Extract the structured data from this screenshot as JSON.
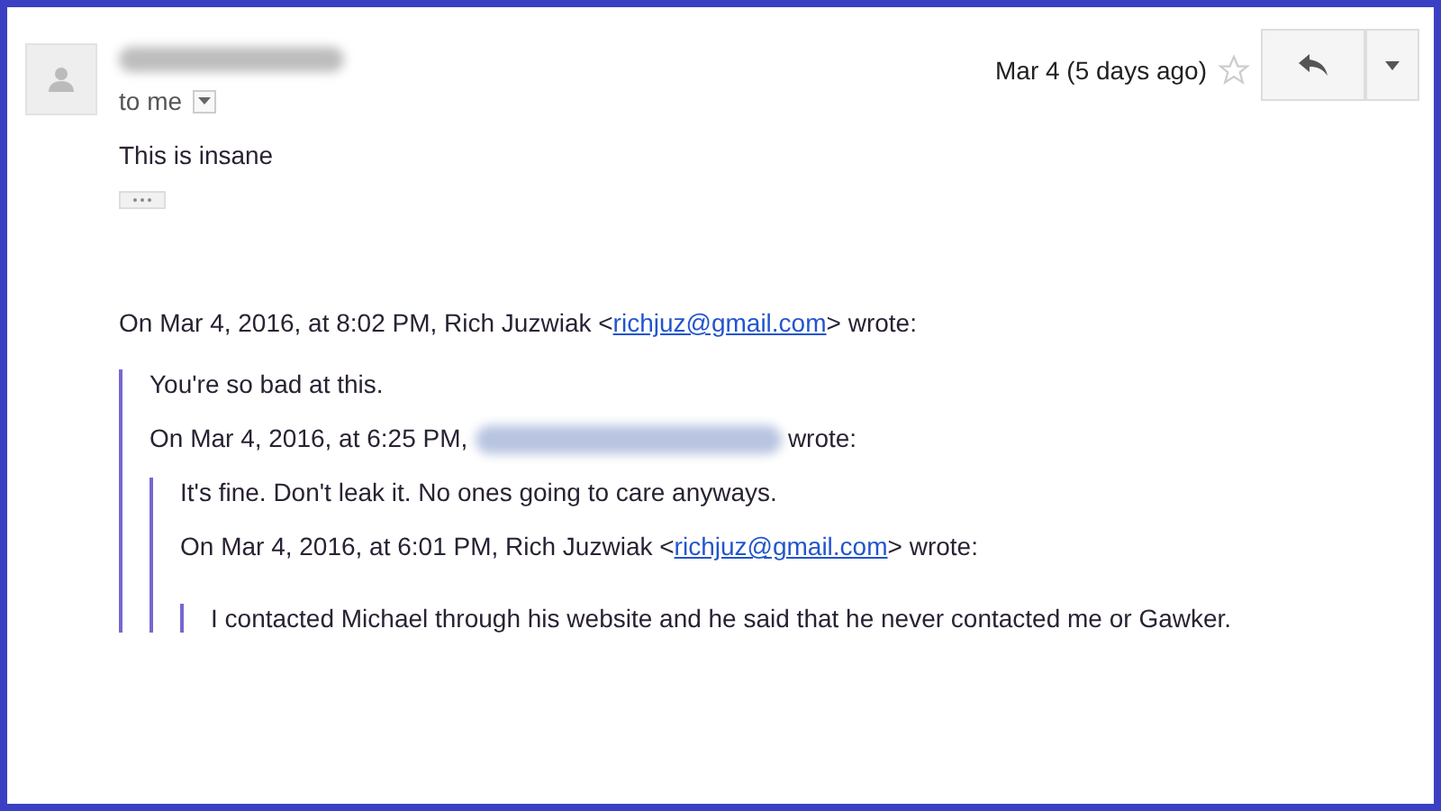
{
  "header": {
    "recipient": "to me",
    "date": "Mar 4 (5 days ago)",
    "starred": false,
    "sender_redacted": true
  },
  "body": "This is insane",
  "thread": {
    "attribution": {
      "prefix": "On Mar 4, 2016, at 8:02 PM, Rich Juzwiak <",
      "email": "richjuz@gmail.com",
      "suffix": "> wrote:"
    },
    "quote": {
      "text": "You're so bad at this.",
      "attribution": {
        "prefix": "On Mar 4, 2016, at 6:25 PM,",
        "sender_redacted": true,
        "suffix": "wrote:"
      },
      "quote": {
        "text": "It's fine. Don't leak it. No ones going to care anyways.",
        "attribution": {
          "prefix": "On Mar 4, 2016, at 6:01 PM, Rich Juzwiak <",
          "email": "richjuz@gmail.com",
          "suffix": "> wrote:"
        },
        "quote": {
          "text": "I contacted Michael through his website and he said that he never contacted me or Gawker."
        }
      }
    }
  }
}
